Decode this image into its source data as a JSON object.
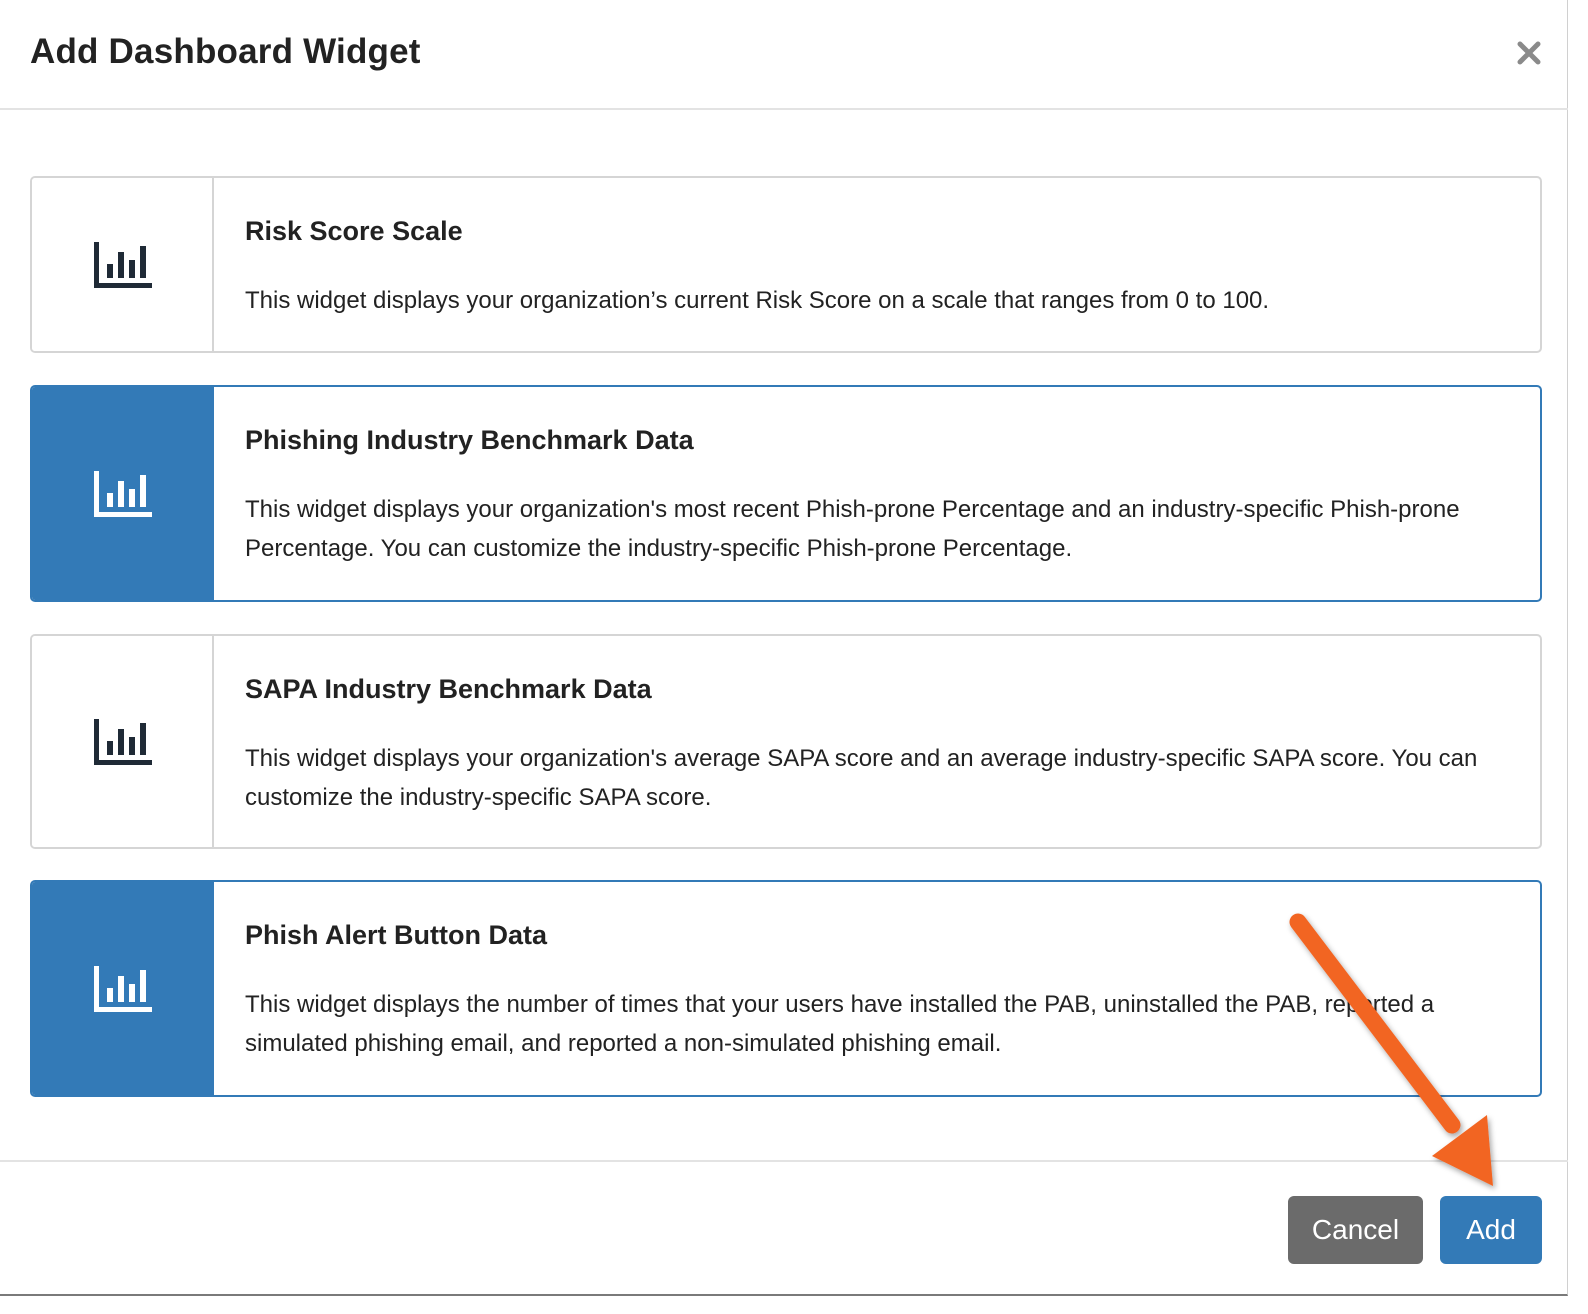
{
  "modal": {
    "title": "Add Dashboard Widget",
    "close_label": "×"
  },
  "widgets": [
    {
      "title": "Risk Score Scale",
      "description": "This widget displays your organization’s current Risk Score on a scale that ranges from 0 to 100.",
      "selected": false,
      "icon": "bar-chart-icon"
    },
    {
      "title": "Phishing Industry Benchmark Data",
      "description": "This widget displays your organization's most recent Phish-prone Percentage and an industry-specific Phish-prone Percentage. You can customize the industry-specific Phish-prone Percentage.",
      "selected": true,
      "icon": "bar-chart-icon"
    },
    {
      "title": "SAPA Industry Benchmark Data",
      "description": "This widget displays your organization's average SAPA score and an average industry-specific SAPA score. You can customize the industry-specific SAPA score.",
      "selected": false,
      "icon": "bar-chart-icon"
    },
    {
      "title": "Phish Alert Button Data",
      "description": "This widget displays the number of times that your users have installed the PAB, uninstalled the PAB, reported a simulated phishing email, and reported a non-simulated phishing email.",
      "selected": true,
      "icon": "bar-chart-icon"
    }
  ],
  "footer": {
    "cancel_label": "Cancel",
    "add_label": "Add"
  },
  "colors": {
    "primary": "#337ab7",
    "cancel": "#6b6b6b",
    "annotation_arrow": "#f26522"
  }
}
